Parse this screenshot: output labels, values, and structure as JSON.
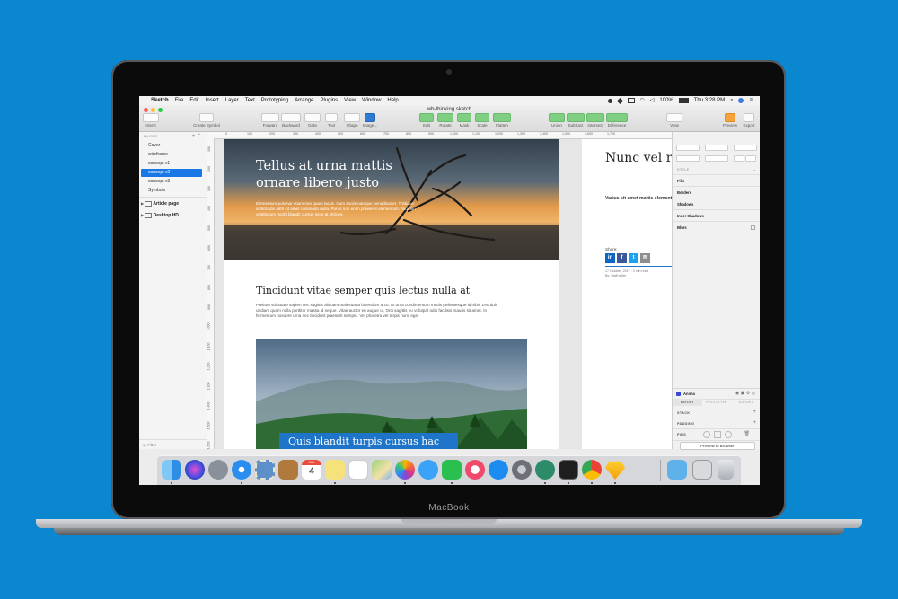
{
  "device": {
    "brand": "MacBook"
  },
  "menubar": {
    "items": [
      "Sketch",
      "File",
      "Edit",
      "Insert",
      "Layer",
      "Text",
      "Prototyping",
      "Arrange",
      "Plugins",
      "View",
      "Window",
      "Help"
    ],
    "battery": "100%",
    "clock": "Thu 3:28 PM"
  },
  "window": {
    "title": "wb-thinking.sketch"
  },
  "toolbar": {
    "insert": "Insert",
    "create_symbol": "Create Symbol",
    "forward": "Forward",
    "backward": "Backward",
    "data": "Data",
    "text": "Text",
    "shape": "Shape",
    "image": "Image...",
    "edit": "Edit",
    "rotate": "Rotate",
    "mask": "Mask",
    "scale": "Scale",
    "flatten": "Flatten",
    "union": "Union",
    "subtract": "Subtract",
    "intersect": "Intersect",
    "difference": "Difference",
    "view": "View",
    "preview": "Preview",
    "export": "Export"
  },
  "pages": {
    "heading": "PAGES",
    "items": [
      "Cover",
      "wireframe",
      "concept v1",
      "concept v2",
      "concept v3",
      "Symbols"
    ],
    "selected": "concept v2",
    "artboards": [
      "Article page",
      "Desktop HD"
    ],
    "filter": "Filter"
  },
  "ruler_top": [
    "0",
    "100",
    "200",
    "300",
    "400",
    "500",
    "600",
    "700",
    "800",
    "900",
    "1,000",
    "1,100",
    "1,200",
    "1,300",
    "1,400",
    "1,500",
    "1,600",
    "1,700"
  ],
  "ruler_left": [
    "100",
    "200",
    "300",
    "400",
    "500",
    "600",
    "700",
    "800",
    "900",
    "1,000",
    "1,100",
    "1,200",
    "1,300",
    "1,400",
    "1,500",
    "1,600"
  ],
  "article": {
    "hero_title": "Tellus at urna mattis ornare libero justo",
    "hero_text": "Elementum pulvinar etiam non quam lacus. Cum sociis natoque penatibus et. Tristique sollicitudin nibh sit amet commodo nulla. Purus non enim praesent elementum. Aliquam vestibulum morbi blandit cursus risus at ultrices.",
    "section_title": "Tincidunt vitae semper quis lectus nulla at",
    "section_body": "Pretium vulputate sapien nec sagittis aliquam malesuada bibendum arcu. At urna condimentum mattis pellentesque id nibh. Leo duis ut diam quam nulla porttitor massa id neque. Vitae auctor eu augue ut. Orci sagittis eu volutpat odio facilisis mauris sit amet. In fermentum posuere urna nec tincidunt praesent semper. Vel pharetra vel turpis nunc eget",
    "caption": "Quis blandit turpis cursus hac"
  },
  "article2": {
    "title": "Nunc vel r commodo",
    "body": "Varius sit amet mattis elementum integer ene porta lorem mollis al",
    "share_label": "Share:",
    "share_icons": [
      "in",
      "f",
      "t",
      "✉"
    ],
    "meta_date": "17 October, 2017 · 3 min read",
    "meta_author": "By: Staff writer"
  },
  "inspector": {
    "style_heading": "STYLE",
    "fills": "Fills",
    "borders": "Borders",
    "shadows": "Shadows",
    "inner_shadows": "Inner Shadows",
    "blurs": "Blurs",
    "plugin_name": "Anima",
    "tabs": [
      "LAYOUT",
      "PROTOTYPE",
      "EXPORT"
    ],
    "stack": "STACK",
    "padding": "PADDING",
    "pins": "PINS",
    "preview_button": "Preview in Browser"
  },
  "dock": {
    "apps": [
      "finder",
      "siri",
      "launchpad",
      "safari",
      "mail-stamp",
      "notes-book",
      "calendar",
      "stickies",
      "reminders",
      "maps",
      "photos",
      "messages",
      "facetime",
      "itunes",
      "app-store",
      "system-preferences",
      "atom",
      "terminal",
      "chrome",
      "sketch"
    ],
    "calendar_month": "JUL",
    "calendar_day": "4",
    "trailing": [
      "downloads-folder",
      "screen-sharing",
      "trash"
    ]
  },
  "colors": {
    "desktop": "#0a87cf",
    "selection": "#1a78e6",
    "caption_bg": "#1e74c8"
  }
}
